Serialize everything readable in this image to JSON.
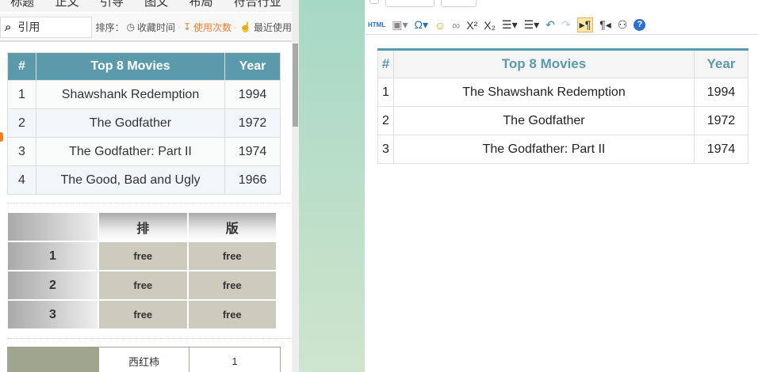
{
  "left": {
    "tabs": [
      "标题",
      "正文",
      "引导",
      "图文",
      "布局",
      "符合行业"
    ],
    "search": {
      "icon": "search-icon",
      "value": "引用"
    },
    "sort": {
      "label": "排序：",
      "options": [
        "收藏时间",
        "使用次数",
        "最近使用"
      ],
      "active": "使用次数"
    },
    "movies": {
      "headers": [
        "#",
        "Top 8 Movies",
        "Year"
      ],
      "rows": [
        [
          "1",
          "Shawshank Redemption",
          "1994"
        ],
        [
          "2",
          "The Godfather",
          "1972"
        ],
        [
          "3",
          "The Godfather: Part II",
          "1974"
        ],
        [
          "4",
          "The Good, Bad and Ugly",
          "1966"
        ]
      ]
    },
    "grid": {
      "headers": [
        "",
        "排",
        "版"
      ],
      "rows": [
        [
          "1",
          "free",
          "free"
        ],
        [
          "2",
          "free",
          "free"
        ],
        [
          "3",
          "free",
          "free"
        ]
      ]
    },
    "table3": {
      "rows": [
        [
          "",
          "西红柿",
          "1"
        ]
      ]
    }
  },
  "editor": {
    "toolbar": [
      "html-icon",
      "image-icon",
      "special-char-icon",
      "emoji-icon",
      "link-icon",
      "superscript-icon",
      "subscript-icon",
      "ordered-list-icon",
      "unordered-list-icon",
      "undo-icon",
      "redo-icon",
      "ltr-icon",
      "rtl-icon",
      "find-icon",
      "help-icon"
    ],
    "html_label": "HTML",
    "table": {
      "headers": [
        "#",
        "Top 8 Movies",
        "Year"
      ],
      "rows": [
        [
          "1",
          "The Shawshank Redemption",
          "1994"
        ],
        [
          "2",
          "The Godfather",
          "1972"
        ],
        [
          "3",
          "The Godfather: Part II",
          "1974"
        ]
      ]
    }
  },
  "colors": {
    "accent": "#5a9aaa",
    "active": "#f07a30"
  }
}
